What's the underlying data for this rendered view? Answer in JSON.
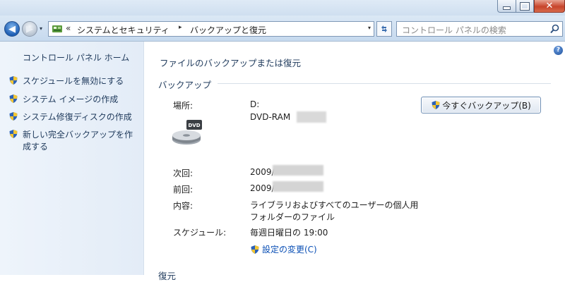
{
  "window": {
    "minimize_glyph": "minimize",
    "maximize_glyph": "maximize",
    "close_glyph": "✕"
  },
  "nav": {
    "back_arrow": "◀",
    "forward_arrow": "▶",
    "dropdown_arrow": "▾",
    "refresh_glyph": "↻"
  },
  "address": {
    "chevron": "«",
    "crumb1": "システムとセキュリティ",
    "separator": "▸",
    "crumb2": "バックアップと復元",
    "dropdown_arrow": "▾"
  },
  "search": {
    "placeholder": "コントロール パネルの検索",
    "icon": "search-icon"
  },
  "sidebar": {
    "home": "コントロール パネル ホーム",
    "tasks": [
      {
        "label": "スケジュールを無効にする",
        "icon": "uac-shield-icon"
      },
      {
        "label": "システム イメージの作成",
        "icon": "uac-shield-icon"
      },
      {
        "label": "システム修復ディスクの作成",
        "icon": "uac-shield-icon"
      },
      {
        "label": "新しい完全バックアップを作成する",
        "icon": "uac-shield-icon"
      }
    ]
  },
  "main": {
    "help": "?",
    "title": "ファイルのバックアップまたは復元",
    "section_backup": "バックアップ",
    "location_label": "場所:",
    "location_value": "D:",
    "drive_name": "DVD-RAM",
    "drive_icon_text": "DVD",
    "backup_now_button": "今すぐバックアップ(B)",
    "next_label": "次回:",
    "next_value": "2009/",
    "prev_label": "前回:",
    "prev_value": "2009/",
    "contents_label": "内容:",
    "contents_value": "ライブラリおよびすべてのユーザーの個人用フォルダーのファイル",
    "schedule_label": "スケジュール:",
    "schedule_value": "毎週日曜日の 19:00",
    "change_settings": "設定の変更(C)",
    "section_restore": "復元"
  },
  "colors": {
    "link": "#0a4fb5",
    "heading": "#1e395b",
    "sidebar_bg": "#e8f0f9",
    "close_button": "#c7442b"
  }
}
